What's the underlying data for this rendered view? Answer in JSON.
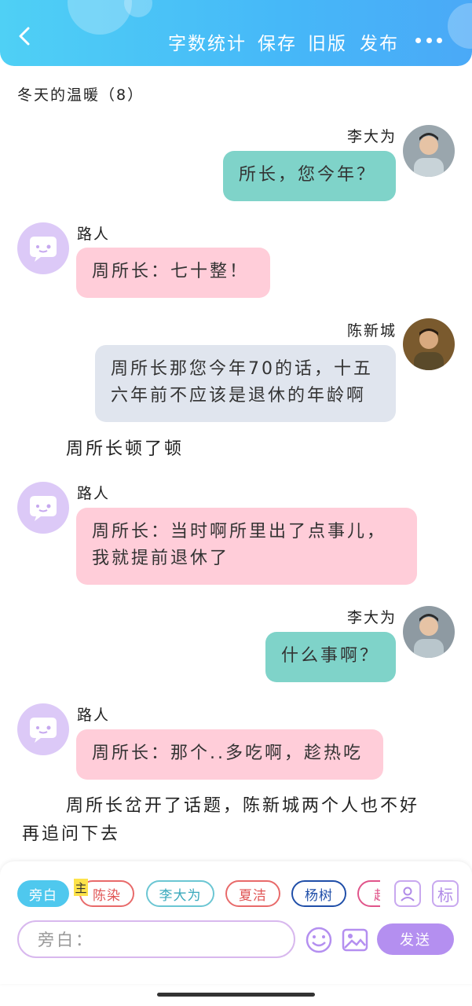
{
  "header": {
    "menu": [
      "字数统计",
      "保存",
      "旧版",
      "发布"
    ]
  },
  "story_title": "冬天的温暖（8）",
  "messages": [
    {
      "speaker": "李大为",
      "text": "所长，您今年？"
    },
    {
      "speaker": "路人",
      "text": "周所长：七十整！"
    },
    {
      "speaker": "陈新城",
      "lines": [
        "周所长那您今年70的话，十五",
        "六年前不应该是退休的年龄啊"
      ]
    },
    {
      "narration": "周所长顿了顿"
    },
    {
      "speaker": "路人",
      "lines": [
        "周所长：当时啊所里出了点事儿，",
        "我就提前退休了"
      ]
    },
    {
      "speaker": "李大为",
      "text": "什么事啊？"
    },
    {
      "speaker": "路人",
      "text": "周所长：那个..多吃啊，趁热吃"
    },
    {
      "narration_lines": [
        "周所长岔开了话题，陈新城两个人也不好",
        "再追问下去"
      ]
    }
  ],
  "footer": {
    "chips": [
      "旁白",
      "陈染",
      "李大为",
      "夏洁",
      "杨树",
      "赵"
    ],
    "main_badge": "主",
    "tool_icon_2": "标",
    "input_placeholder": "旁白：",
    "send_label": "发送"
  },
  "colors": {
    "header": "#46b8f8",
    "teal_bubble": "#7fd3c9",
    "pink_bubble": "#ffcdd9",
    "gray_bubble": "#e0e5ee",
    "send": "#b48ff0"
  }
}
